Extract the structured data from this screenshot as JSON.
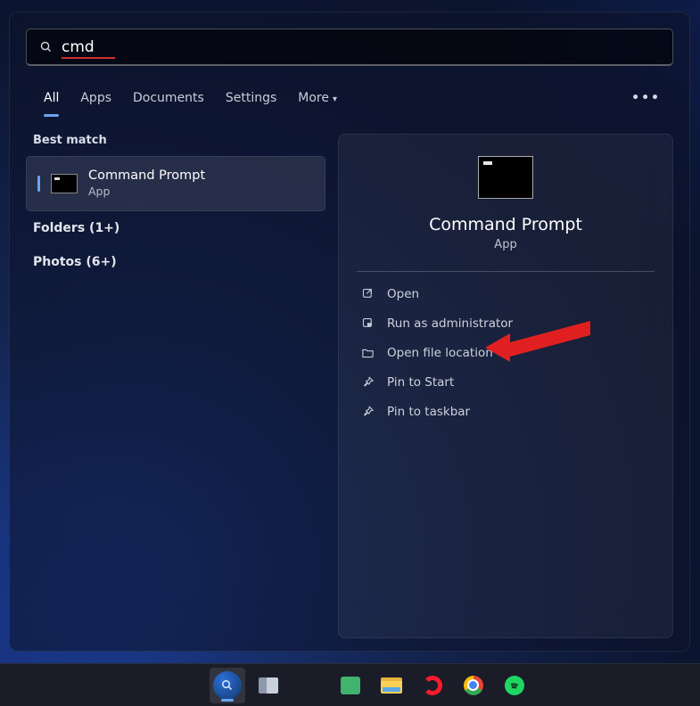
{
  "search": {
    "query": "cmd"
  },
  "tabs": {
    "items": [
      "All",
      "Apps",
      "Documents",
      "Settings",
      "More"
    ],
    "active_index": 0
  },
  "left": {
    "best_match_label": "Best match",
    "result": {
      "title": "Command Prompt",
      "subtitle": "App"
    },
    "other": [
      {
        "label": "Folders (1+)"
      },
      {
        "label": "Photos (6+)"
      }
    ]
  },
  "preview": {
    "title": "Command Prompt",
    "subtitle": "App",
    "actions": [
      {
        "icon": "open-icon",
        "label": "Open"
      },
      {
        "icon": "shield-icon",
        "label": "Run as administrator"
      },
      {
        "icon": "folder-icon",
        "label": "Open file location"
      },
      {
        "icon": "pin-icon",
        "label": "Pin to Start"
      },
      {
        "icon": "pin-icon",
        "label": "Pin to taskbar"
      }
    ]
  },
  "taskbar": {
    "icons": [
      "start-icon",
      "search-icon",
      "task-view-icon",
      "widgets-icon",
      "chat-icon",
      "file-explorer-icon",
      "opera-icon",
      "chrome-icon",
      "spotify-icon"
    ],
    "active_index": 1
  }
}
